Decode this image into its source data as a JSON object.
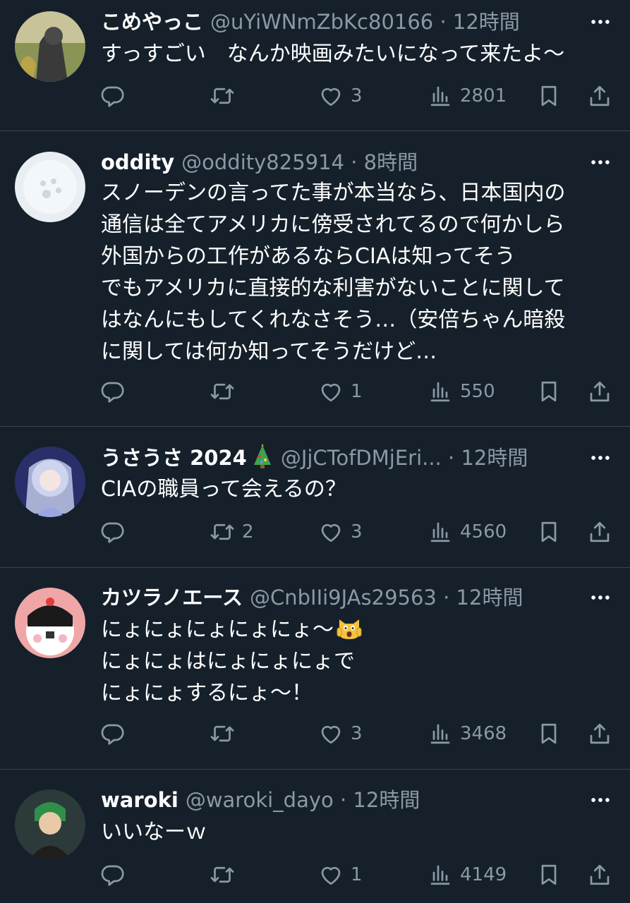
{
  "tweets": [
    {
      "name": "こめやっこ",
      "handle": "@uYiWNmZbKc80166",
      "sep": "·",
      "time": "12時間",
      "lines": [
        "すっすごい　なんか映画みたいになって来たよ～"
      ],
      "retweets": "",
      "likes": "3",
      "views": "2801"
    },
    {
      "name": "oddity",
      "handle": "@oddity825914",
      "sep": "·",
      "time": "8時間",
      "lines": [
        "スノーデンの言ってた事が本当なら、日本国内の",
        "通信は全てアメリカに傍受されてるので何かしら",
        "外国からの工作があるならCIAは知ってそう",
        "でもアメリカに直接的な利害がないことに関して",
        "はなんにもしてくれなさそう…（安倍ちゃん暗殺",
        "に関しては何か知ってそうだけど…"
      ],
      "retweets": "",
      "likes": "1",
      "views": "550"
    },
    {
      "name": "うさうさ 2024",
      "name_emoji": "christmas-tree",
      "handle": "@JjCTofDMjEri...",
      "sep": "·",
      "time": "12時間",
      "lines": [
        "CIAの職員って会えるの？"
      ],
      "retweets": "2",
      "likes": "3",
      "views": "4560"
    },
    {
      "name": "カツラノエース",
      "handle": "@CnbIIi9JAs29563",
      "sep": "·",
      "time": "12時間",
      "lines": [
        "にょにょにょにょにょ～",
        "にょにょはにょにょにょで",
        "にょにょするにょ～！"
      ],
      "line_emoji": "screaming-cat",
      "retweets": "",
      "likes": "3",
      "views": "3468"
    },
    {
      "name": "waroki",
      "handle": "@waroki_dayo",
      "sep": "·",
      "time": "12時間",
      "lines": [
        "いいなーｗ"
      ],
      "retweets": "",
      "likes": "1",
      "views": "4149"
    }
  ],
  "icons": {
    "more": "more-icon",
    "reply": "reply-icon",
    "retweet": "retweet-icon",
    "like": "heart-icon",
    "views": "views-icon",
    "bookmark": "bookmark-icon",
    "share": "share-icon"
  },
  "colors": {
    "background": "#15202b",
    "text": "#ffffff",
    "secondary": "#8b98a5",
    "divider": "#38444d"
  }
}
